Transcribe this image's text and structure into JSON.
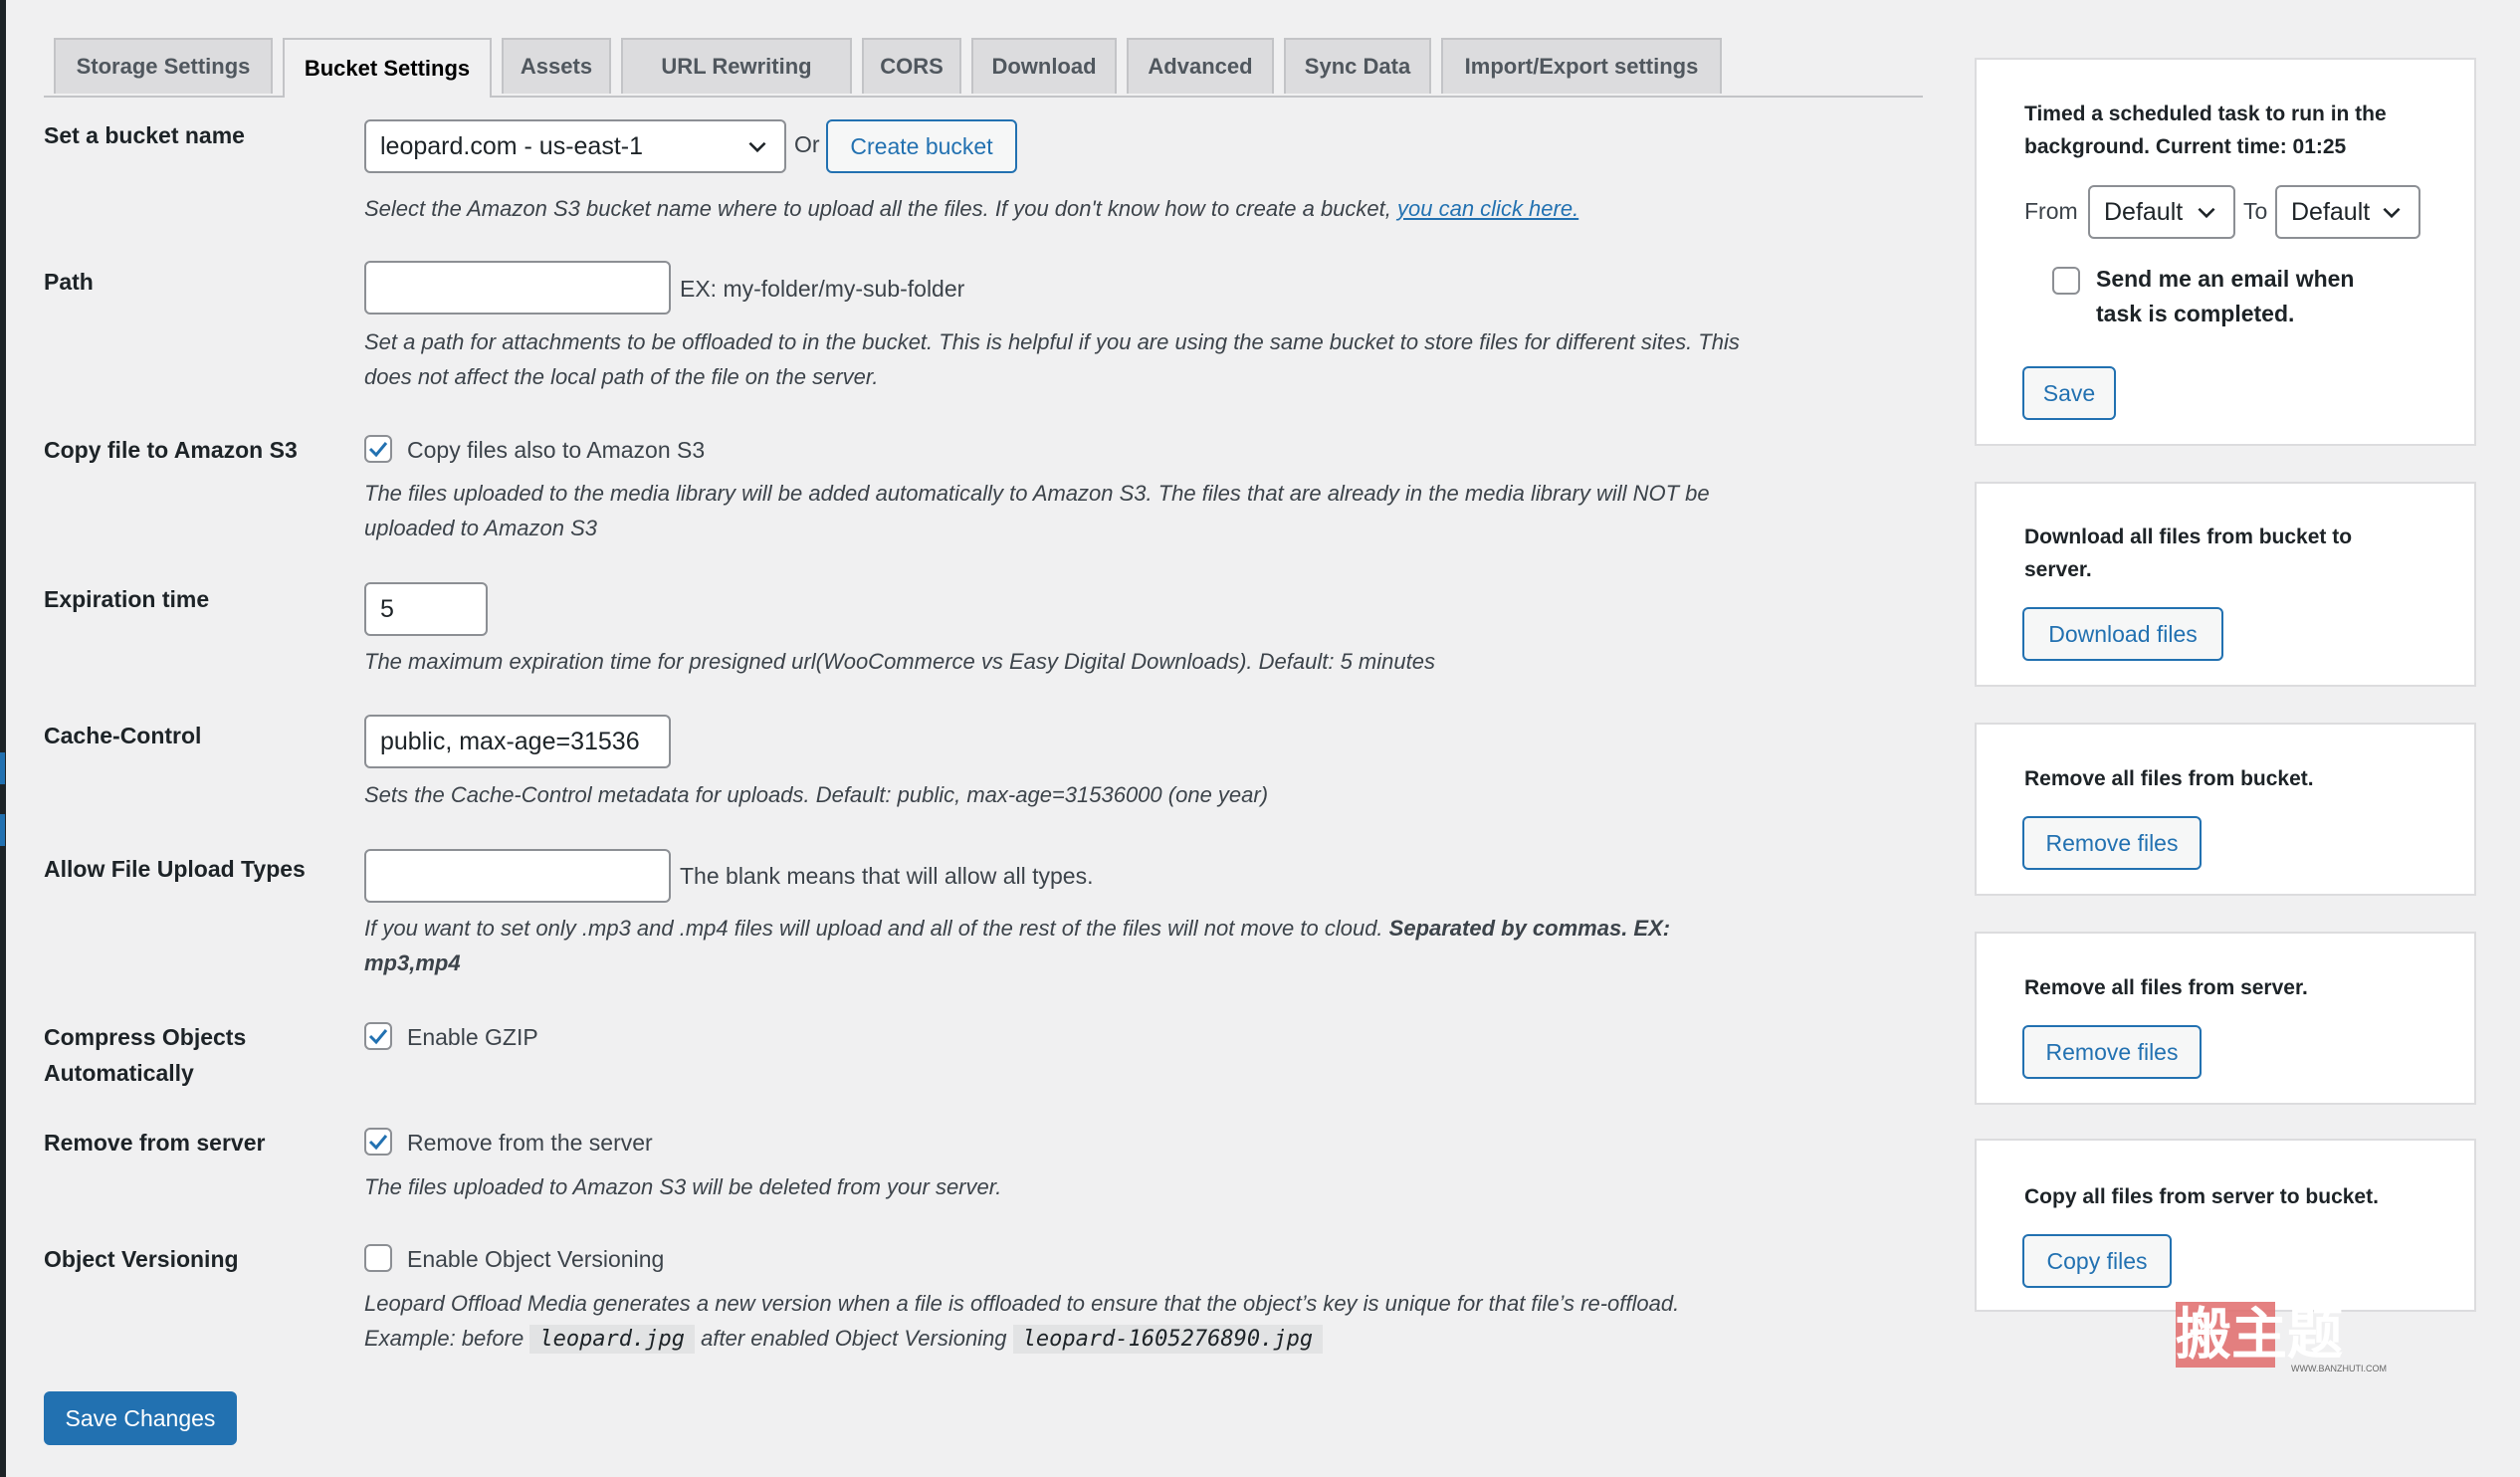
{
  "tabs": [
    {
      "label": "Storage Settings",
      "active": false
    },
    {
      "label": "Bucket Settings",
      "active": true
    },
    {
      "label": "Assets",
      "active": false
    },
    {
      "label": "URL Rewriting",
      "active": false
    },
    {
      "label": "CORS",
      "active": false
    },
    {
      "label": "Download",
      "active": false
    },
    {
      "label": "Advanced",
      "active": false
    },
    {
      "label": "Sync Data",
      "active": false
    },
    {
      "label": "Import/Export settings",
      "active": false
    }
  ],
  "bucket": {
    "label": "Set a bucket name",
    "selected": "leopard.com - us-east-1",
    "or_text": "Or",
    "create_button": "Create bucket",
    "desc": "Select the Amazon S3 bucket name where to upload all the files. If you don't know how to create a bucket, ",
    "desc_link": "you can click here."
  },
  "path": {
    "label": "Path",
    "value": "",
    "hint": "EX: my-folder/my-sub-folder",
    "desc_line1": "Set a path for attachments to be offloaded to in the bucket. This is helpful if you are using the same bucket to store files for different sites. This",
    "desc_line2": "does not affect the local path of the file on the server."
  },
  "copy": {
    "label": "Copy file to Amazon S3",
    "checkbox_label": "Copy files also to Amazon S3",
    "checked": true,
    "desc_line1": "The files uploaded to the media library will be added automatically to Amazon S3. The files that are already in the media library will NOT be",
    "desc_line2": "uploaded to Amazon S3"
  },
  "expiration": {
    "label": "Expiration time",
    "value": "5",
    "desc": "The maximum expiration time for presigned url(WooCommerce vs Easy Digital Downloads). Default: 5 minutes"
  },
  "cache": {
    "label": "Cache-Control",
    "value": "public, max-age=31536",
    "desc": "Sets the Cache-Control metadata for uploads. Default: public, max-age=31536000 (one year)"
  },
  "upload_types": {
    "label": "Allow File Upload Types",
    "value": "",
    "hint": "The blank means that will allow all types.",
    "desc_line1": "If you want to set only .mp3 and .mp4 files will upload and all of the rest of the files will not move to cloud. ",
    "desc_line1_bold": "Separated by commas. EX:",
    "desc_line2_bold": "mp3,mp4"
  },
  "compress": {
    "label_line1": "Compress Objects",
    "label_line2": "Automatically",
    "checkbox_label": "Enable GZIP",
    "checked": true
  },
  "remove": {
    "label": "Remove from server",
    "checkbox_label": "Remove from the server",
    "checked": true,
    "desc": "The files uploaded to Amazon S3 will be deleted from your server."
  },
  "versioning": {
    "label": "Object Versioning",
    "checkbox_label": "Enable Object Versioning",
    "checked": false,
    "desc_line1": "Leopard Offload Media generates a new version when a file is offloaded to ensure that the object’s key is unique for that file’s re-offload.",
    "desc_prefix": "Example: before",
    "code_before": "leopard.jpg",
    "desc_middle": "after enabled Object Versioning",
    "code_after": "leopard-1605276890.jpg"
  },
  "save_changes": "Save Changes",
  "sidebar": {
    "schedule": {
      "title_line1": "Timed a scheduled task to run in the",
      "title_line2": "background. Current time: 01:25",
      "from_label": "From",
      "from_value": "Default",
      "to_label": "To",
      "to_value": "Default",
      "email_line1": "Send me an email when",
      "email_line2": "task is completed.",
      "email_checked": false,
      "save": "Save"
    },
    "download": {
      "title_line1": "Download all files from bucket to",
      "title_line2": "server.",
      "button": "Download files"
    },
    "remove_bucket": {
      "title": "Remove all files from bucket.",
      "button": "Remove files"
    },
    "remove_server": {
      "title": "Remove all files from server.",
      "button": "Remove files"
    },
    "copy_bucket": {
      "title": "Copy all files from server to bucket.",
      "button": "Copy files"
    }
  },
  "watermark": {
    "text": "搬主题",
    "url": "WWW.BANZHUTI.COM"
  },
  "colors": {
    "accent": "#2271b1",
    "background": "#f0f0f1",
    "watermark_red": "#d63638"
  }
}
